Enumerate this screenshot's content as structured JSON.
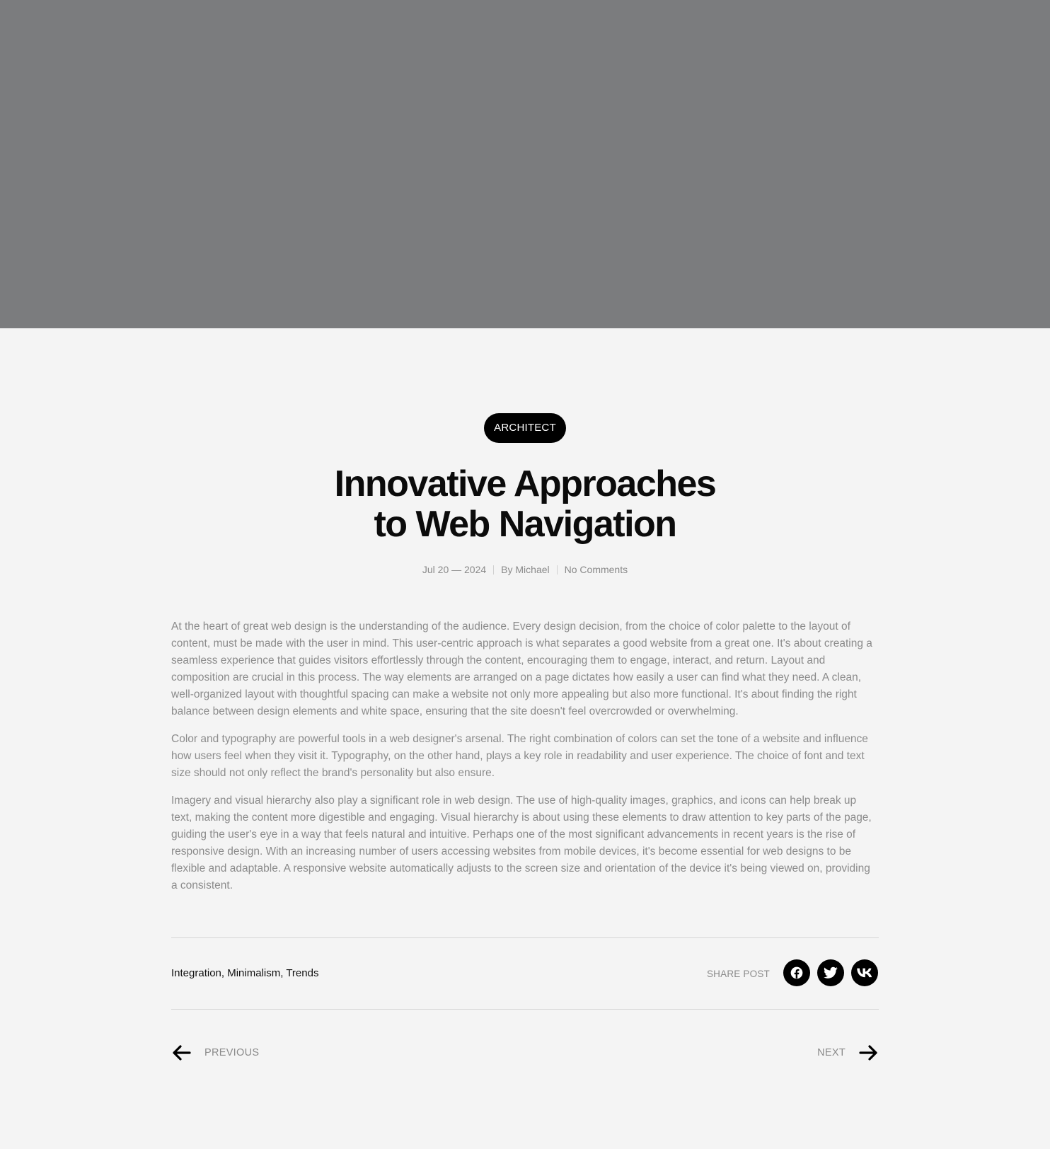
{
  "post": {
    "category": "ARCHITECT",
    "title_line1": "Innovative Approaches",
    "title_line2": "to Web Navigation",
    "date": "Jul 20 — 2024",
    "author": "By Michael",
    "comments": "No Comments",
    "paragraphs": [
      "At the heart of great web design is the understanding of the audience. Every design decision, from the choice of color palette to the layout of content, must be made with the user in mind. This user-centric approach is what separates a good website from a great one. It's about creating a seamless experience that guides visitors effortlessly through the content, encouraging them to engage, interact, and return. Layout and composition are crucial in this process. The way elements are arranged on a page dictates how easily a user can find what they need. A clean, well-organized layout with thoughtful spacing can make a website not only more appealing but also more functional. It's about finding the right balance between design elements and white space, ensuring that the site doesn't feel overcrowded or overwhelming.",
      "Color and typography are powerful tools in a web designer's arsenal. The right combination of colors can set the tone of a website and influence how users feel when they visit it. Typography, on the other hand, plays a key role in readability and user experience. The choice of font and text size should not only reflect the brand's personality but also ensure.",
      "Imagery and visual hierarchy also play a significant role in web design. The use of high-quality images, graphics, and icons can help break up text, making the content more digestible and engaging. Visual hierarchy is about using these elements to draw attention to key parts of the page, guiding the user's eye in a way that feels natural and intuitive. Perhaps one of the most significant advancements in recent years is the rise of responsive design. With an increasing number of users accessing websites from mobile devices, it's become essential for web designs to be flexible and adaptable. A responsive website automatically adjusts to the screen size and orientation of the device it's being viewed on, providing a consistent."
    ]
  },
  "tags": [
    "Integration",
    "Minimalism",
    "Trends"
  ],
  "share": {
    "label": "SHARE POST",
    "networks": [
      {
        "name": "facebook",
        "icon": "facebook-icon"
      },
      {
        "name": "twitter",
        "icon": "twitter-icon"
      },
      {
        "name": "vk",
        "icon": "vk-icon"
      }
    ]
  },
  "navigation": {
    "previous_label": "PREVIOUS",
    "next_label": "NEXT"
  },
  "colors": {
    "hero_placeholder": "#7b7c7e",
    "background": "#f4f4f4",
    "accent": "#000000",
    "muted_text": "#8b8b8b"
  }
}
